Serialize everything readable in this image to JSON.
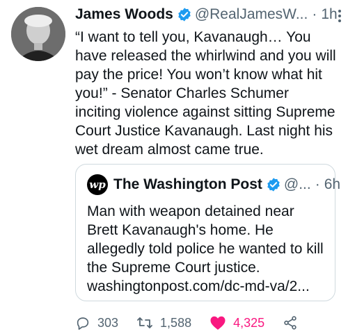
{
  "author": {
    "name": "James Woods",
    "handle": "@RealJamesW...",
    "separator": "·",
    "time": "1h",
    "text": "“I want to tell you, Kavanaugh… You\nhave released the whirlwind and you will\npay the price! You won’t know what hit\nyou!” - Senator Charles Schumer\ninciting violence against sitting Supreme\nCourt Justice Kavanaugh. Last night his\nwet dream almost came true."
  },
  "quoted": {
    "logo_text": "wp",
    "name": "The Washington Post",
    "handle": "@...",
    "separator": "·",
    "time": "6h",
    "text": "Man with weapon detained near\nBrett Kavanaugh's home. He\nallegedly told police he wanted to kill\nthe Supreme Court justice.\nwashingtonpost.com/dc-md-va/2..."
  },
  "actions": {
    "replies": "303",
    "retweets": "1,588",
    "likes": "4,325"
  },
  "colors": {
    "verified": "#1d9bf0",
    "like": "#f91880",
    "muted": "#536471"
  },
  "icons": [
    "verified-badge-icon",
    "more-options-icon",
    "reply-icon",
    "retweet-icon",
    "like-heart-icon",
    "share-icon"
  ]
}
